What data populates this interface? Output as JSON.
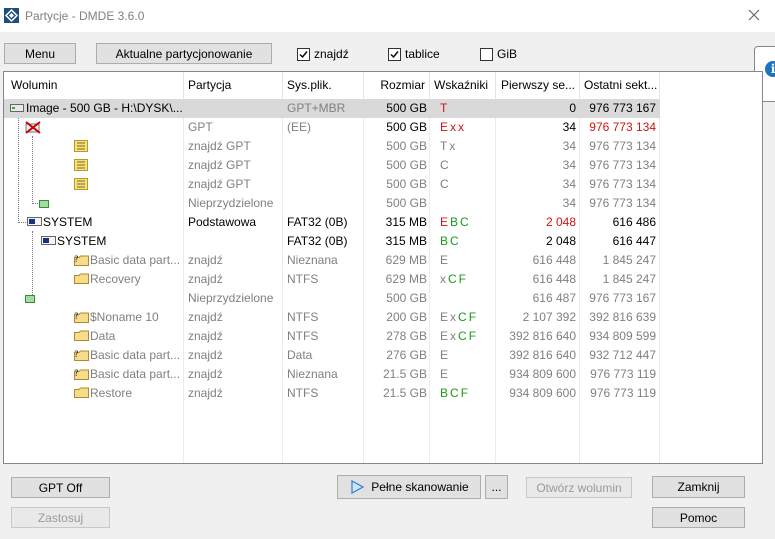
{
  "window": {
    "title": "Partycje - DMDE 3.6.0"
  },
  "toolbar": {
    "menu_label": "Menu",
    "current_partitioning_label": "Aktualne partycjonowanie",
    "found_label": "znajdź",
    "found_checked": true,
    "tables_label": "tablice",
    "tables_checked": true,
    "gib_label": "GiB",
    "gib_checked": false
  },
  "columns": [
    "Wolumin",
    "Partycja",
    "Sys.plik.",
    "Rozmiar",
    "Wskaźniki",
    "Pierwszy se...",
    "Ostatni sekt..."
  ],
  "rows": [
    {
      "name": "Image - 500 GB - H:\\DYSK\\...",
      "partition": "",
      "fs": "GPT+MBR",
      "size": "500 GB",
      "flags": "T",
      "first": "0",
      "last": "976 773 167"
    },
    {
      "name": "",
      "partition": "GPT",
      "fs": "(EE)",
      "size": "500 GB",
      "flags": "Exx",
      "first": "34",
      "last": "976 773 134"
    },
    {
      "name": "",
      "partition": "znajdź GPT",
      "fs": "",
      "size": "500 GB",
      "flags": "Tx",
      "first": "34",
      "last": "976 773 134"
    },
    {
      "name": "",
      "partition": "znajdź GPT",
      "fs": "",
      "size": "500 GB",
      "flags": "C",
      "first": "34",
      "last": "976 773 134"
    },
    {
      "name": "",
      "partition": "znajdź GPT",
      "fs": "",
      "size": "500 GB",
      "flags": "C",
      "first": "34",
      "last": "976 773 134"
    },
    {
      "name": "",
      "partition": "Nieprzydzielone",
      "fs": "",
      "size": "500 GB",
      "flags": "",
      "first": "34",
      "last": "976 773 134"
    },
    {
      "name": "SYSTEM",
      "partition": "Podstawowa",
      "fs": "FAT32 (0B)",
      "size": "315 MB",
      "flags": "EBC",
      "first": "2 048",
      "last": "616 486"
    },
    {
      "name": "SYSTEM",
      "partition": "",
      "fs": "FAT32 (0B)",
      "size": "315 MB",
      "flags": "BC",
      "first": "2 048",
      "last": "616 447"
    },
    {
      "name": "Basic data part...",
      "partition": "znajdź",
      "fs": "Nieznana",
      "size": "629 MB",
      "flags": "E",
      "first": "616 448",
      "last": "1 845 247"
    },
    {
      "name": "Recovery",
      "partition": "znajdź",
      "fs": "NTFS",
      "size": "629 MB",
      "flags": "xCF",
      "first": "616 448",
      "last": "1 845 247"
    },
    {
      "name": "",
      "partition": "Nieprzydzielone",
      "fs": "",
      "size": "500 GB",
      "flags": "",
      "first": "616 487",
      "last": "976 773 167"
    },
    {
      "name": "$Noname 10",
      "partition": "znajdź",
      "fs": "NTFS",
      "size": "200 GB",
      "flags": "ExCF",
      "first": "2 107 392",
      "last": "392 816 639"
    },
    {
      "name": "Data",
      "partition": "znajdź",
      "fs": "NTFS",
      "size": "278 GB",
      "flags": "ExCF",
      "first": "392 816 640",
      "last": "934 809 599"
    },
    {
      "name": "Basic data part...",
      "partition": "znajdź",
      "fs": "Data",
      "size": "276 GB",
      "flags": "E",
      "first": "392 816 640",
      "last": "932 712 447"
    },
    {
      "name": "Basic data part...",
      "partition": "znajdź",
      "fs": "Nieznana",
      "size": "21.5 GB",
      "flags": "E",
      "first": "934 809 600",
      "last": "976 773 119"
    },
    {
      "name": "Restore",
      "partition": "znajdź",
      "fs": "NTFS",
      "size": "21.5 GB",
      "flags": "BCF",
      "first": "934 809 600",
      "last": "976 773 119"
    }
  ],
  "buttons": {
    "gpt_off": "GPT Off",
    "apply": "Zastosuj",
    "full_scan": "Pełne skanowanie",
    "more": "...",
    "open_volume": "Otwórz wolumin",
    "close": "Zamknij",
    "help": "Pomoc"
  },
  "colors": {
    "red": "#d11414",
    "green": "#1a9a1a",
    "gray": "#808080",
    "selection": "#d9d9d9"
  }
}
